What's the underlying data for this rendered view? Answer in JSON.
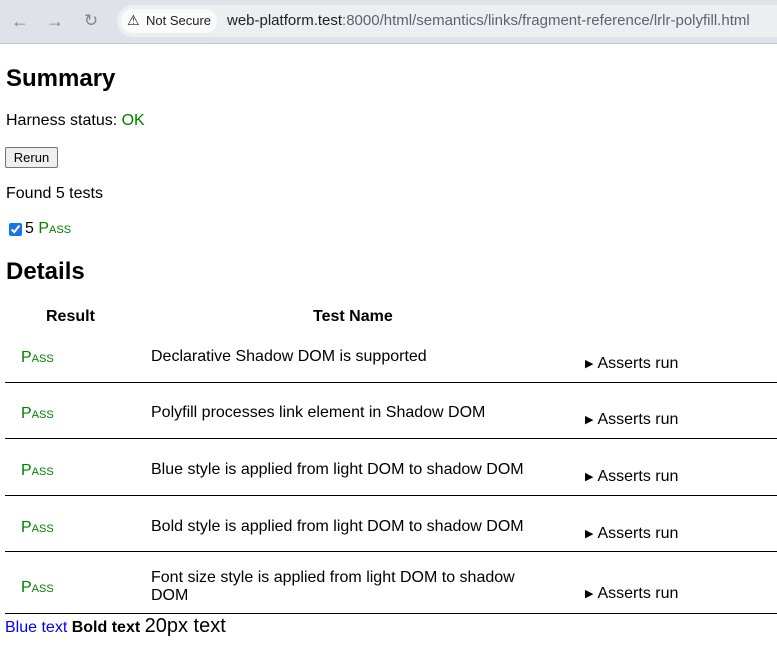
{
  "browser": {
    "security_label": "Not Secure",
    "url_host": "web-platform.test",
    "url_rest": ":8000/html/semantics/links/fragment-reference/lrlr-polyfill.html"
  },
  "summary": {
    "title": "Summary",
    "harness_label": "Harness status:",
    "harness_value": "OK",
    "rerun_label": "Rerun",
    "found_text": "Found 5 tests",
    "pass_count": "5",
    "pass_label": "Pass"
  },
  "details": {
    "title": "Details",
    "headers": {
      "result": "Result",
      "name": "Test Name"
    },
    "rows": [
      {
        "status": "Pass",
        "name": "Declarative Shadow DOM is supported",
        "asserts": "Asserts run"
      },
      {
        "status": "Pass",
        "name": "Polyfill processes link element in Shadow DOM",
        "asserts": "Asserts run"
      },
      {
        "status": "Pass",
        "name": "Blue style is applied from light DOM to shadow DOM",
        "asserts": "Asserts run"
      },
      {
        "status": "Pass",
        "name": "Bold style is applied from light DOM to shadow DOM",
        "asserts": "Asserts run"
      },
      {
        "status": "Pass",
        "name": "Font size style is applied from light DOM to shadow DOM",
        "asserts": "Asserts run"
      }
    ]
  },
  "footer": {
    "blue": "Blue text",
    "bold": "Bold text",
    "big": "20px text"
  },
  "colors": {
    "pass": "#008000",
    "blue": "#0000ff"
  }
}
